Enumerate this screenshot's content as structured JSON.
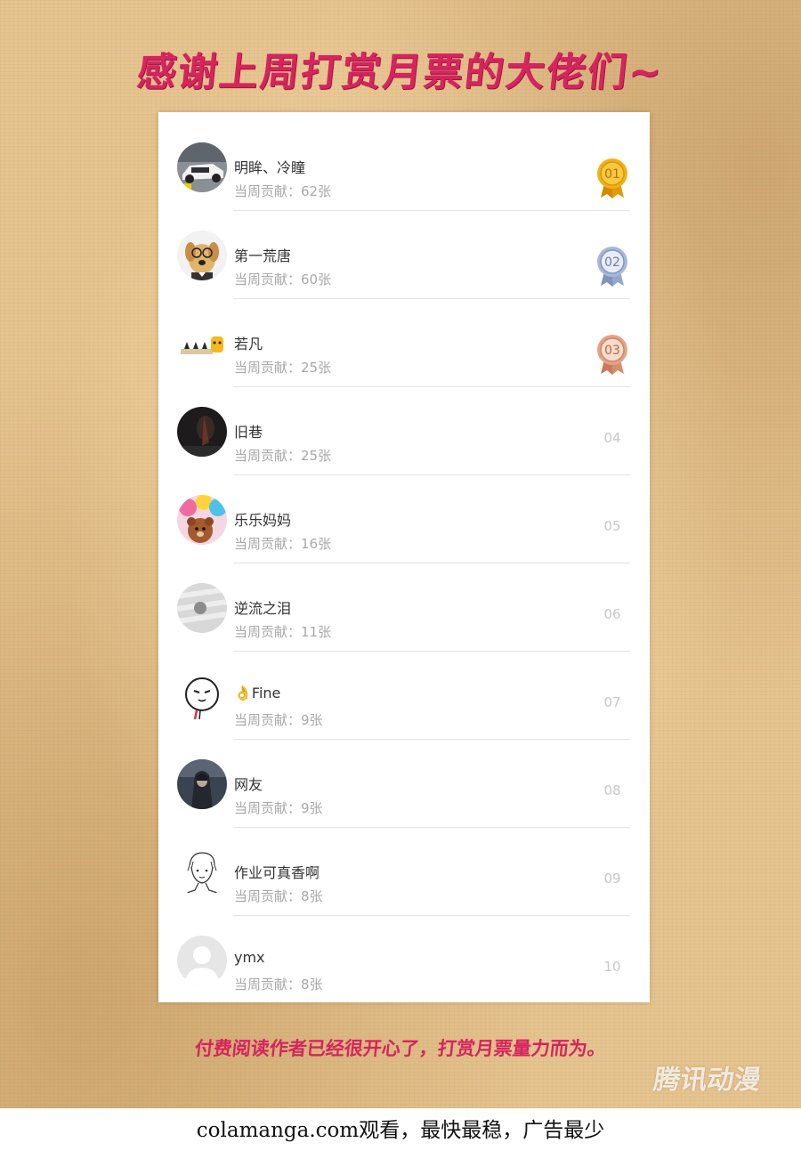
{
  "header": {
    "title": "感谢上周打赏月票的大佬们~"
  },
  "ranking": {
    "contribution_prefix": "当周贡献：",
    "items": [
      {
        "rank": "01",
        "name": "明眸、冷瞳",
        "contribution": "当周贡献：62张",
        "medal": "gold",
        "avatar_icon": "car-avatar-icon"
      },
      {
        "rank": "02",
        "name": "第一荒唐",
        "contribution": "当周贡献：60张",
        "medal": "silver",
        "avatar_icon": "dog-avatar-icon"
      },
      {
        "rank": "03",
        "name": "若凡",
        "contribution": "当周贡献：25张",
        "medal": "bronze",
        "avatar_icon": "cartoon-avatar-icon"
      },
      {
        "rank": "04",
        "name": "旧巷",
        "contribution": "当周贡献：25张",
        "medal": "none",
        "avatar_icon": "dark-photo-avatar-icon"
      },
      {
        "rank": "05",
        "name": "乐乐妈妈",
        "contribution": "当周贡献：16张",
        "medal": "none",
        "avatar_icon": "teddy-bear-avatar-icon"
      },
      {
        "rank": "06",
        "name": "逆流之泪",
        "contribution": "当周贡献：11张",
        "medal": "none",
        "avatar_icon": "gray-abstract-avatar-icon"
      },
      {
        "rank": "07",
        "name": "👌Fine",
        "contribution": "当周贡献：9张",
        "medal": "none",
        "avatar_icon": "doodle-face-avatar-icon"
      },
      {
        "rank": "08",
        "name": "网友",
        "contribution": "当周贡献：9张",
        "medal": "none",
        "avatar_icon": "hooded-figure-avatar-icon"
      },
      {
        "rank": "09",
        "name": "作业可真香啊",
        "contribution": "当周贡献：8张",
        "medal": "none",
        "avatar_icon": "sketch-boy-avatar-icon"
      },
      {
        "rank": "10",
        "name": "ymx",
        "contribution": "当周贡献：8张",
        "medal": "none",
        "avatar_icon": "default-user-avatar-icon"
      }
    ]
  },
  "footer": {
    "note": "付费阅读作者已经很开心了，打赏月票量力而为。",
    "watermark": "腾讯动漫"
  },
  "bottom_bar": {
    "text": "colamanga.com观看，最快最稳，广告最少"
  },
  "colors": {
    "accent": "#d6245e",
    "paper": "#e6c48f",
    "gold": "#f0b21b",
    "silver": "#8fa2c6",
    "bronze": "#d99579"
  }
}
